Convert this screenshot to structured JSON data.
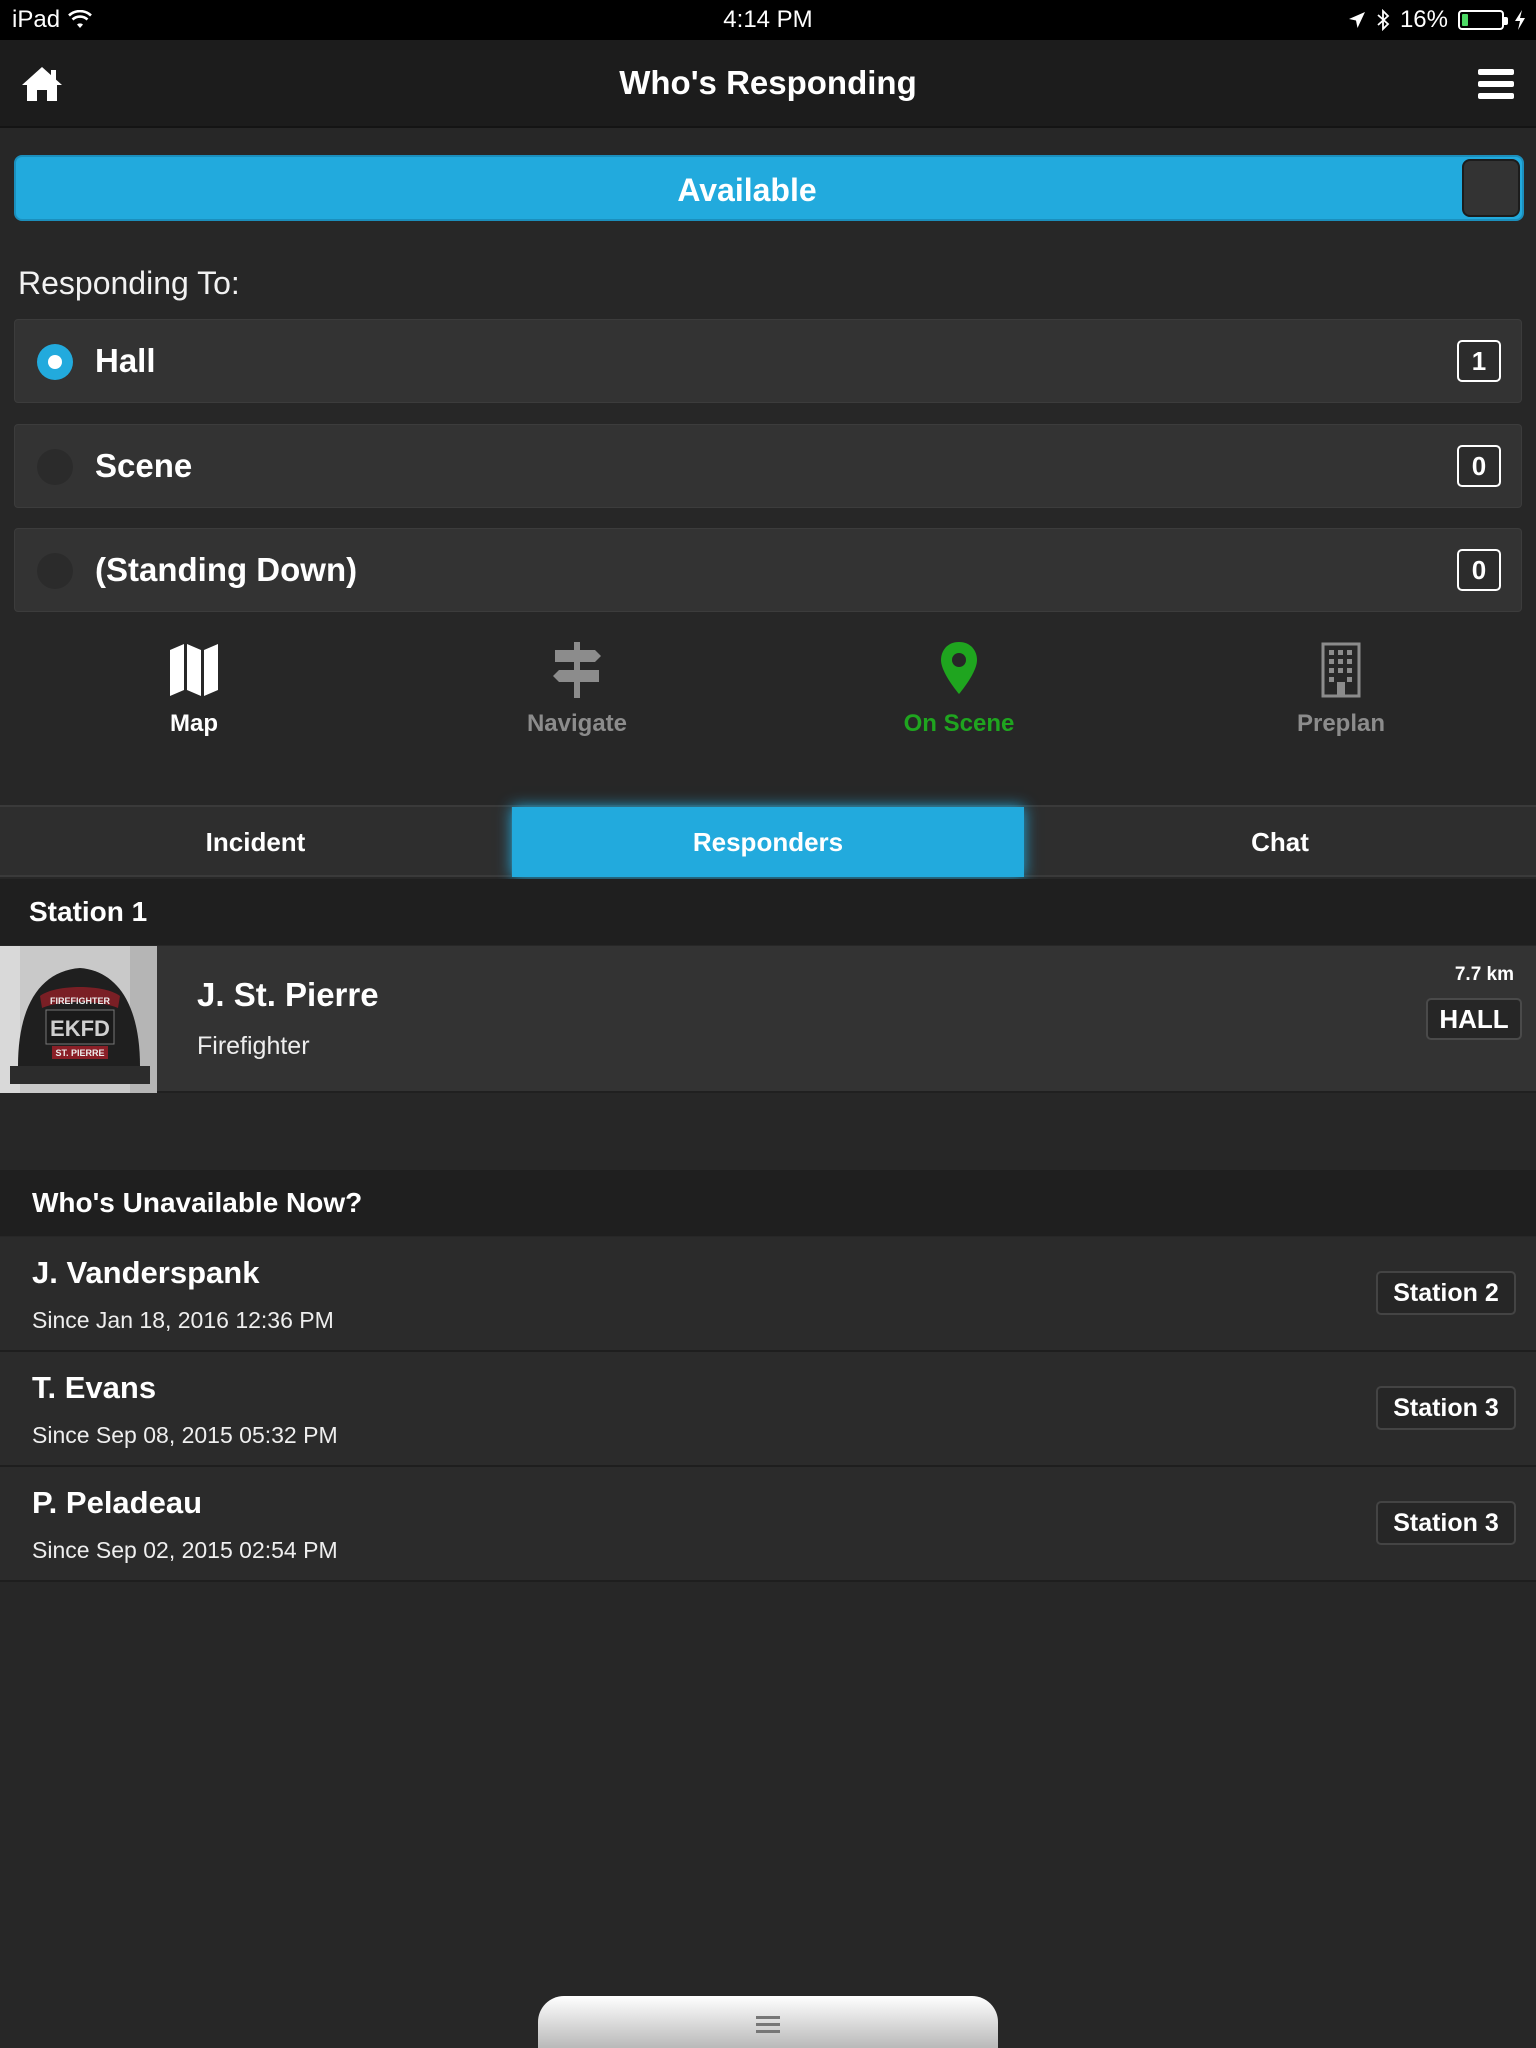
{
  "status_bar": {
    "device": "iPad",
    "time": "4:14 PM",
    "battery_percent": "16%",
    "battery_level": 0.16
  },
  "navbar": {
    "title": "Who's Responding",
    "home_icon": "home-icon",
    "menu_icon": "hamburger-menu-icon"
  },
  "availability": {
    "label": "Available",
    "on": true
  },
  "responding": {
    "label": "Responding To:",
    "options": [
      {
        "name": "Hall",
        "count": "1",
        "selected": true
      },
      {
        "name": "Scene",
        "count": "0",
        "selected": false
      },
      {
        "name": "(Standing Down)",
        "count": "0",
        "selected": false
      }
    ]
  },
  "actions": [
    {
      "label": "Map",
      "icon": "map-icon",
      "color": "#ffffff"
    },
    {
      "label": "Navigate",
      "icon": "signpost-icon",
      "color": "#8c8c8c"
    },
    {
      "label": "On Scene",
      "icon": "map-pin-icon",
      "color": "#1fa51f"
    },
    {
      "label": "Preplan",
      "icon": "building-icon",
      "color": "#8c8c8c"
    }
  ],
  "tabs": [
    {
      "label": "Incident",
      "active": false
    },
    {
      "label": "Responders",
      "active": true
    },
    {
      "label": "Chat",
      "active": false
    }
  ],
  "station": {
    "header": "Station 1",
    "responders": [
      {
        "name": "J. St. Pierre",
        "role": "Firefighter",
        "distance": "7.7 km",
        "location": "HALL",
        "photo_text_top": "FIREFIGHTER",
        "photo_text_main": "EKFD",
        "photo_text_bottom": "ST. PIERRE"
      }
    ]
  },
  "unavailable": {
    "header": "Who's Unavailable Now?",
    "people": [
      {
        "name": "J. Vanderspank",
        "since": "Since Jan 18, 2016 12:36 PM",
        "station": "Station 2"
      },
      {
        "name": "T. Evans",
        "since": "Since Sep 08, 2015 05:32 PM",
        "station": "Station 3"
      },
      {
        "name": "P. Peladeau",
        "since": "Since Sep 02, 2015 02:54 PM",
        "station": "Station 3"
      }
    ]
  },
  "colors": {
    "accent": "#22aadd",
    "background": "#272727",
    "on_scene": "#1fa51f"
  }
}
